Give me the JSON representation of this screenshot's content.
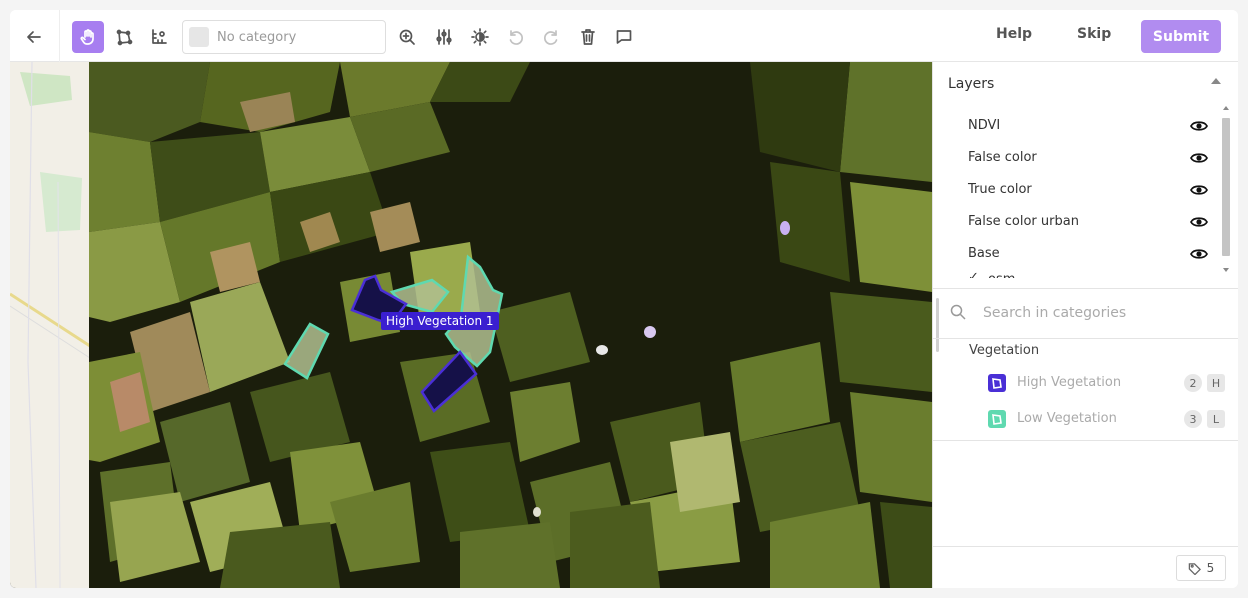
{
  "toolbar": {
    "category_placeholder": "No category",
    "help_label": "Help",
    "skip_label": "Skip",
    "submit_label": "Submit"
  },
  "map": {
    "polygon_label": "High Vegetation 1"
  },
  "panel": {
    "layers_title": "Layers",
    "layers": [
      {
        "label": "NDVI"
      },
      {
        "label": "False color"
      },
      {
        "label": "True color"
      },
      {
        "label": "False color urban"
      },
      {
        "label": "Base"
      },
      {
        "label": "osm",
        "checked": true
      }
    ],
    "search_placeholder": "Search in categories",
    "group_title": "Vegetation",
    "categories": [
      {
        "label": "High Vegetation",
        "count": "2",
        "key": "H",
        "color": "#4a2fd6"
      },
      {
        "label": "Low Vegetation",
        "count": "3",
        "key": "L",
        "color": "#5fd9b0"
      }
    ],
    "tag_count": "5"
  },
  "colors": {
    "accent": "#a77ef0",
    "submit": "#b18cf0",
    "high_vegetation": "#3a1fd0",
    "low_vegetation": "#5fd9b0"
  }
}
